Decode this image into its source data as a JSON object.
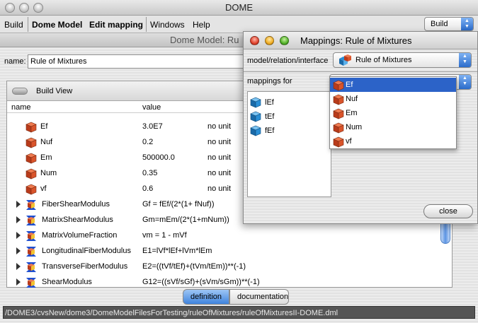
{
  "window": {
    "title": "DOME"
  },
  "menu": {
    "build": "Build",
    "dome_model": "Dome Model",
    "edit_mapping": "Edit mapping",
    "windows": "Windows",
    "help": "Help"
  },
  "build_select": {
    "value": "Build"
  },
  "doc": {
    "title": "Dome Model: Ru",
    "name_label": "name:",
    "name_value": "Rule of Mixtures",
    "view_label": "Build View",
    "col_name": "name",
    "col_value": "value"
  },
  "rows": [
    {
      "name": "Ef",
      "value": "3.0E7",
      "unit": "no unit"
    },
    {
      "name": "Nuf",
      "value": "0.2",
      "unit": "no unit"
    },
    {
      "name": "Em",
      "value": "500000.0",
      "unit": "no unit"
    },
    {
      "name": "Num",
      "value": "0.35",
      "unit": "no unit"
    },
    {
      "name": "vf",
      "value": "0.6",
      "unit": "no unit"
    },
    {
      "name": "FiberShearModulus",
      "value": "Gf = fEf/(2*(1+ fNuf))"
    },
    {
      "name": "MatrixShearModulus",
      "value": "Gm=mEm/(2*(1+mNum))"
    },
    {
      "name": "MatrixVolumeFraction",
      "value": "vm = 1 - mVf"
    },
    {
      "name": "LongitudinalFiberModulus",
      "value": "E1=lVf*lEf+lVm*lEm"
    },
    {
      "name": "TransverseFiberModulus",
      "value": "E2=((tVf/tEf)+(tVm/tEm))**(-1)"
    },
    {
      "name": "ShearModulus",
      "value": "G12=((sVf/sGf)+(sVm/sGm))**(-1)"
    }
  ],
  "tabs": {
    "definition": "definition",
    "documentation": "documentation"
  },
  "status": {
    "path": "/DOME3/cvsNew/dome3/DomeModelFilesForTesting/ruleOfMixtures/ruleOfMixturesII-DOME.dml"
  },
  "dialog": {
    "title": "Mappings: Rule of Mixtures",
    "rel_label": "model/relation/interface",
    "rel_value": "Rule of Mixtures",
    "mappings_label": "mappings for",
    "list": [
      "lEf",
      "tEf",
      "fEf"
    ],
    "dropdown": [
      "Ef",
      "Nuf",
      "Em",
      "Num",
      "vf"
    ],
    "close_label": "close"
  },
  "colors": {
    "cube_red": "#d9542b",
    "cube_blue": "#2a8fd6",
    "selection": "#2c63c8"
  }
}
